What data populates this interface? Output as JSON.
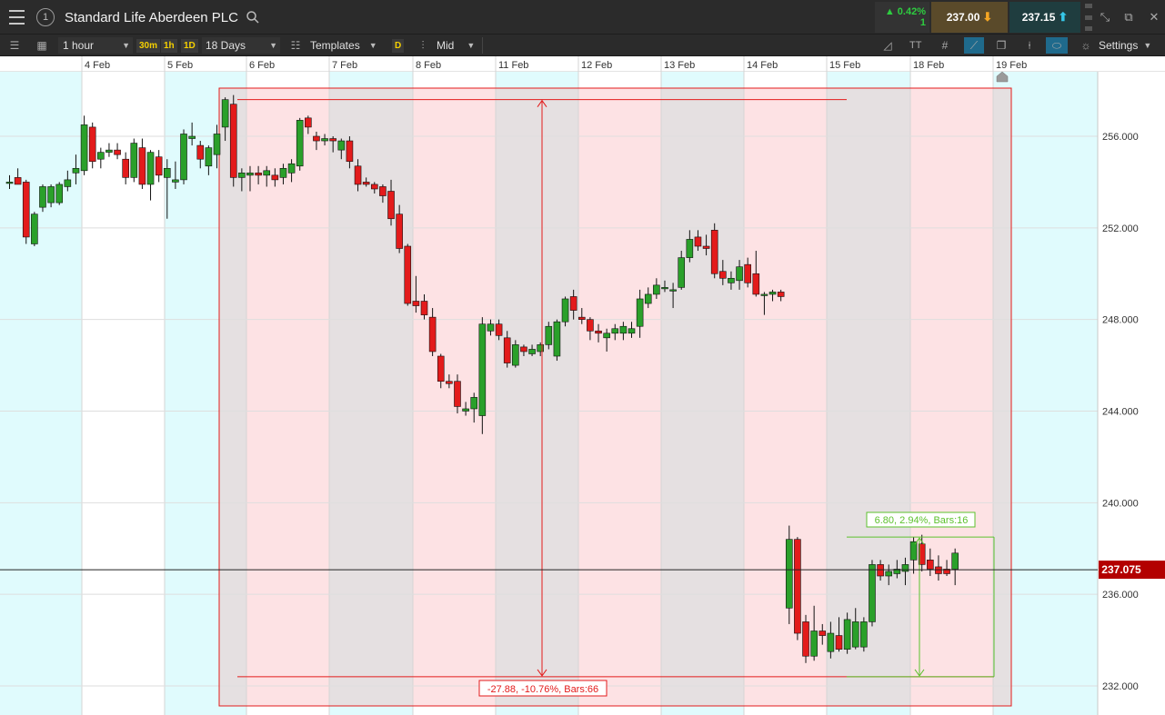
{
  "header": {
    "instrument_name": "Standard Life Aberdeen PLC",
    "circle_label": "1",
    "change_pct": "▲ 0.42%",
    "change_sub": "1",
    "sell_price": "237.00",
    "buy_price": "237.15"
  },
  "toolbar": {
    "interval": "1 hour",
    "quick_30m": "30m",
    "quick_1h": "1h",
    "quick_1d": "1D",
    "range": "18 Days",
    "templates": "Templates",
    "d_badge": "D",
    "price_type": "Mid",
    "settings": "Settings",
    "text_tool": "TT"
  },
  "colors": {
    "up": "#2aa02a",
    "down": "#e31b1b",
    "range_fill": "#fde2e4",
    "range_border": "#e31b1b",
    "weekend_band": "#e5e0e1",
    "session_band": "#e0fbfd",
    "measure_green": "#5cc12d",
    "price_tag": "#b30000"
  },
  "chart_data": {
    "type": "candlestick",
    "date_labels": [
      "4 Feb",
      "5 Feb",
      "6 Feb",
      "7 Feb",
      "8 Feb",
      "11 Feb",
      "12 Feb",
      "13 Feb",
      "14 Feb",
      "15 Feb",
      "18 Feb",
      "19 Feb"
    ],
    "y_ticks": [
      "256.000",
      "252.000",
      "248.000",
      "244.000",
      "240.000",
      "236.000",
      "232.000"
    ],
    "ylim": [
      231.2,
      258.6
    ],
    "current_price": 237.075,
    "current_price_label": "237.075",
    "measure_down_label": "-27.88, -10.76%, Bars:66",
    "measure_up_label": "6.80, 2.94%, Bars:16",
    "measure_down": {
      "high": 257.6,
      "low": 232.4
    },
    "measure_up": {
      "high": 238.5,
      "low": 232.4
    },
    "candles": [
      [
        254.0,
        254.3,
        253.7,
        254.0
      ],
      [
        254.2,
        254.6,
        253.9,
        253.9
      ],
      [
        254.0,
        254.1,
        251.3,
        251.6
      ],
      [
        251.3,
        252.7,
        251.2,
        252.6
      ],
      [
        252.9,
        253.9,
        252.7,
        253.8
      ],
      [
        253.1,
        253.9,
        252.9,
        253.8
      ],
      [
        253.1,
        254.0,
        253.0,
        253.9
      ],
      [
        253.8,
        254.5,
        253.6,
        254.1
      ],
      [
        254.4,
        255.2,
        253.9,
        254.6
      ],
      [
        254.5,
        256.9,
        254.3,
        256.5
      ],
      [
        256.4,
        256.6,
        254.6,
        254.9
      ],
      [
        255.0,
        255.5,
        254.6,
        255.3
      ],
      [
        255.3,
        255.7,
        255.1,
        255.4
      ],
      [
        255.4,
        255.7,
        255.0,
        255.2
      ],
      [
        255.0,
        255.3,
        253.9,
        254.2
      ],
      [
        254.2,
        255.9,
        254.0,
        255.7
      ],
      [
        255.5,
        255.9,
        253.7,
        253.9
      ],
      [
        253.9,
        255.4,
        253.2,
        255.3
      ],
      [
        255.1,
        255.4,
        254.0,
        254.3
      ],
      [
        254.2,
        255.0,
        252.4,
        254.6
      ],
      [
        254.0,
        254.9,
        253.7,
        254.1
      ],
      [
        254.1,
        256.3,
        253.9,
        256.1
      ],
      [
        255.9,
        256.6,
        255.6,
        256.0
      ],
      [
        255.6,
        255.8,
        254.6,
        255.0
      ],
      [
        254.7,
        255.6,
        254.3,
        255.5
      ],
      [
        255.2,
        256.5,
        254.6,
        256.1
      ],
      [
        256.4,
        257.7,
        255.8,
        257.6
      ],
      [
        257.4,
        257.8,
        253.8,
        254.2
      ],
      [
        254.2,
        254.6,
        253.6,
        254.4
      ],
      [
        254.3,
        254.7,
        253.6,
        254.4
      ],
      [
        254.4,
        254.7,
        253.9,
        254.3
      ],
      [
        254.3,
        254.7,
        253.8,
        254.5
      ],
      [
        254.3,
        254.6,
        253.8,
        254.1
      ],
      [
        254.2,
        254.8,
        253.9,
        254.6
      ],
      [
        254.4,
        255.0,
        254.0,
        254.8
      ],
      [
        254.7,
        256.8,
        254.5,
        256.7
      ],
      [
        256.8,
        256.9,
        256.1,
        256.4
      ],
      [
        256.0,
        256.2,
        255.4,
        255.8
      ],
      [
        255.8,
        256.1,
        255.6,
        255.9
      ],
      [
        255.9,
        256.0,
        255.3,
        255.8
      ],
      [
        255.4,
        255.9,
        255.0,
        255.8
      ],
      [
        255.8,
        256.0,
        254.6,
        254.9
      ],
      [
        254.7,
        255.0,
        253.6,
        253.9
      ],
      [
        254.0,
        254.2,
        253.8,
        253.9
      ],
      [
        253.9,
        254.0,
        253.5,
        253.7
      ],
      [
        253.8,
        253.9,
        253.1,
        253.4
      ],
      [
        253.6,
        254.1,
        252.1,
        252.4
      ],
      [
        252.6,
        253.0,
        250.9,
        251.1
      ],
      [
        251.2,
        251.3,
        248.6,
        248.7
      ],
      [
        248.8,
        249.9,
        248.3,
        248.6
      ],
      [
        248.8,
        249.1,
        248.0,
        248.2
      ],
      [
        248.1,
        248.5,
        246.4,
        246.6
      ],
      [
        246.4,
        246.5,
        245.0,
        245.3
      ],
      [
        245.3,
        245.6,
        245.0,
        245.2
      ],
      [
        245.3,
        245.6,
        243.9,
        244.2
      ],
      [
        244.0,
        244.4,
        243.8,
        244.1
      ],
      [
        244.1,
        244.8,
        243.5,
        244.6
      ],
      [
        243.8,
        248.1,
        243.0,
        247.8
      ],
      [
        247.5,
        248.0,
        247.3,
        247.8
      ],
      [
        247.8,
        248.0,
        247.1,
        247.3
      ],
      [
        247.2,
        247.5,
        245.9,
        246.1
      ],
      [
        246.0,
        247.1,
        245.9,
        246.9
      ],
      [
        246.8,
        246.9,
        246.4,
        246.6
      ],
      [
        246.5,
        246.9,
        246.4,
        246.7
      ],
      [
        246.6,
        247.0,
        246.4,
        246.9
      ],
      [
        246.9,
        247.9,
        246.7,
        247.7
      ],
      [
        246.4,
        248.0,
        246.2,
        247.9
      ],
      [
        247.9,
        249.0,
        247.7,
        248.9
      ],
      [
        249.0,
        249.3,
        248.0,
        248.4
      ],
      [
        248.1,
        248.5,
        247.8,
        248.0
      ],
      [
        248.0,
        248.1,
        247.1,
        247.5
      ],
      [
        247.5,
        247.8,
        247.0,
        247.4
      ],
      [
        247.2,
        247.6,
        246.6,
        247.4
      ],
      [
        247.4,
        247.8,
        247.1,
        247.6
      ],
      [
        247.4,
        247.9,
        247.1,
        247.7
      ],
      [
        247.4,
        247.9,
        247.2,
        247.6
      ],
      [
        247.7,
        249.3,
        247.2,
        248.9
      ],
      [
        248.7,
        249.4,
        248.5,
        249.1
      ],
      [
        249.1,
        249.8,
        248.9,
        249.5
      ],
      [
        249.4,
        249.7,
        249.2,
        249.4
      ],
      [
        249.3,
        249.6,
        248.5,
        249.3
      ],
      [
        249.4,
        251.0,
        249.3,
        250.7
      ],
      [
        250.7,
        251.9,
        250.5,
        251.5
      ],
      [
        251.6,
        251.9,
        251.0,
        251.2
      ],
      [
        251.2,
        251.7,
        250.8,
        251.1
      ],
      [
        251.9,
        252.2,
        249.8,
        250.0
      ],
      [
        250.1,
        250.6,
        249.5,
        249.8
      ],
      [
        249.6,
        250.1,
        249.3,
        249.8
      ],
      [
        249.7,
        250.6,
        249.3,
        250.3
      ],
      [
        250.4,
        250.7,
        249.4,
        249.6
      ],
      [
        250.0,
        251.0,
        249.0,
        249.1
      ],
      [
        249.1,
        249.2,
        248.2,
        249.1
      ],
      [
        249.1,
        249.3,
        248.8,
        249.2
      ],
      [
        249.2,
        249.3,
        248.8,
        249.0
      ],
      [
        235.4,
        239.0,
        234.7,
        238.4
      ],
      [
        238.4,
        238.5,
        234.0,
        234.3
      ],
      [
        234.8,
        235.1,
        233.0,
        233.3
      ],
      [
        233.3,
        235.5,
        233.1,
        234.4
      ],
      [
        234.4,
        234.7,
        233.8,
        234.2
      ],
      [
        233.5,
        234.8,
        233.2,
        234.3
      ],
      [
        234.2,
        235.0,
        233.5,
        233.6
      ],
      [
        233.6,
        235.2,
        233.4,
        234.9
      ],
      [
        233.7,
        235.4,
        233.6,
        234.8
      ],
      [
        233.7,
        235.0,
        233.5,
        234.8
      ],
      [
        234.8,
        237.5,
        234.6,
        237.3
      ],
      [
        237.3,
        237.5,
        236.6,
        236.8
      ],
      [
        236.8,
        237.3,
        236.4,
        237.0
      ],
      [
        236.9,
        237.5,
        236.7,
        237.1
      ],
      [
        237.0,
        237.6,
        236.4,
        237.3
      ],
      [
        237.5,
        238.5,
        236.9,
        238.3
      ],
      [
        238.2,
        238.6,
        237.0,
        237.3
      ],
      [
        237.5,
        238.0,
        236.8,
        237.1
      ],
      [
        237.2,
        237.7,
        236.6,
        236.9
      ],
      [
        237.1,
        237.5,
        236.8,
        236.9
      ],
      [
        237.1,
        238.0,
        236.4,
        237.8
      ]
    ]
  }
}
